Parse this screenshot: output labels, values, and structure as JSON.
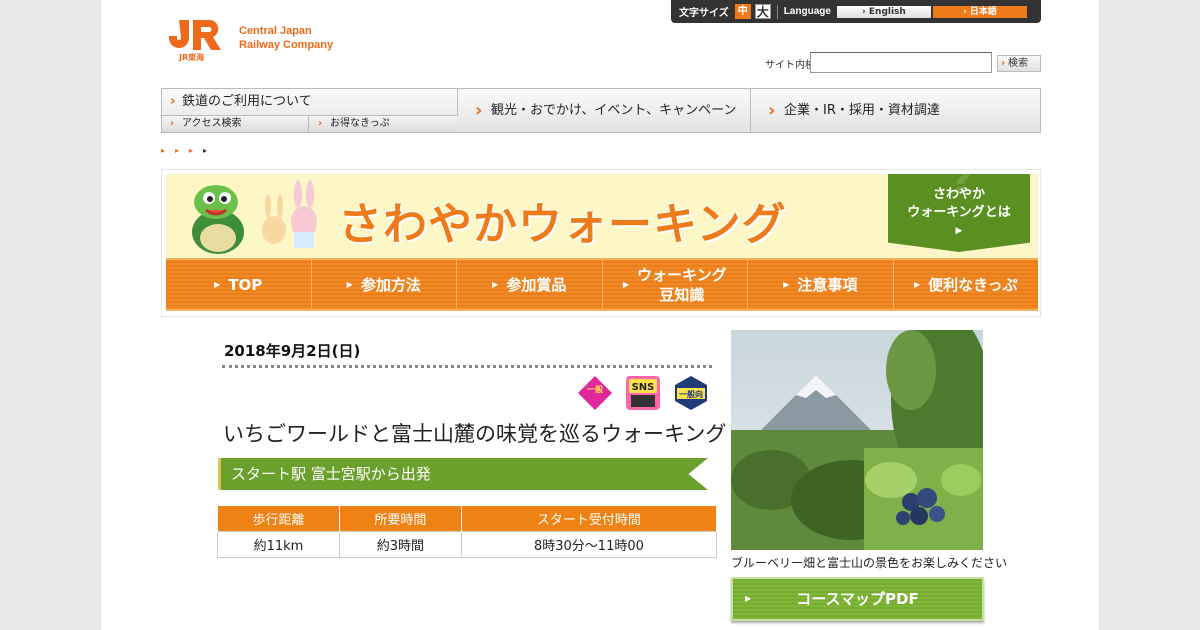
{
  "brand": {
    "logo_text_line1": "Central Japan",
    "logo_text_line2": "Railway Company",
    "logo_mark_text": "JR東海",
    "accent": "#ee6a1a"
  },
  "utility": {
    "font_size_label": "文字サイズ",
    "font_mid": "中",
    "font_large": "大",
    "language_label": "Language",
    "lang_english": "› English",
    "lang_japanese": "› 日本語"
  },
  "search": {
    "label": "サイト内検索",
    "placeholder": "",
    "button_label": "検索"
  },
  "gnav": {
    "rail_use": "鉄道のご利用について",
    "access_search": "アクセス検索",
    "tickets": "お得なきっぷ",
    "tourism": "観光・おでかけ、イベント、キャンペーン",
    "corporate": "企業・IR・採用・資材調達"
  },
  "banner": {
    "title": "さわやかウォーキング",
    "about_line1": "さわやか",
    "about_line2": "ウォーキングとは",
    "tabs": [
      "TOP",
      "参加方法",
      "参加賞品",
      "ウォーキング\n豆知識",
      "注意事項",
      "便利なきっぷ"
    ]
  },
  "event": {
    "date": "2018年9月2日(日)",
    "badges": [
      "一般",
      "SNS",
      "一般向"
    ],
    "title": "いちごワールドと富士山麓の味覚を巡るウォーキング",
    "course_name": "スタート駅 富士宮駅から出発",
    "table": {
      "headers": [
        "歩行距離",
        "所要時間",
        "スタート受付時間"
      ],
      "values": [
        "約11km",
        "約3時間",
        "8時30分～11時00"
      ]
    }
  },
  "photo": {
    "caption": "ブルーベリー畑と富士山の景色をお楽しみください"
  },
  "pdf_button": "コースマップPDF",
  "colors": {
    "orange": "#ee8214",
    "green": "#6aa12c",
    "banner_bg": "#fdf7c8"
  }
}
